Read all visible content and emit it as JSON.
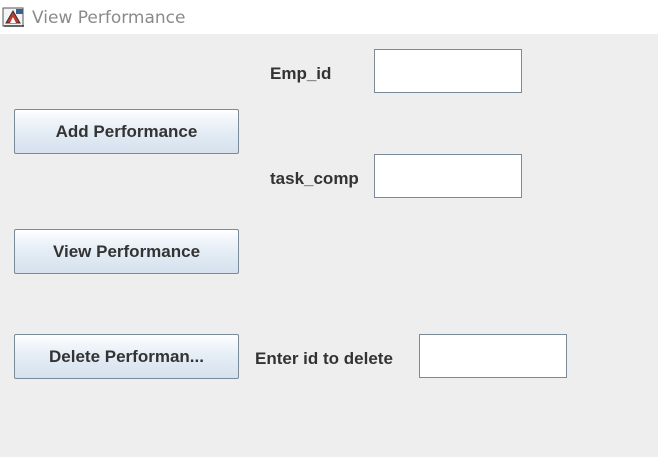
{
  "window": {
    "title": "View Performance",
    "icon": "java-cup-icon"
  },
  "form": {
    "emp_id_label": "Emp_id",
    "emp_id_value": "",
    "task_comp_label": "task_comp",
    "task_comp_value": "",
    "delete_id_label": "Enter id to delete",
    "delete_id_value": ""
  },
  "buttons": {
    "add": "Add Performance",
    "view": "View Performance",
    "delete": "Delete Performan..."
  }
}
